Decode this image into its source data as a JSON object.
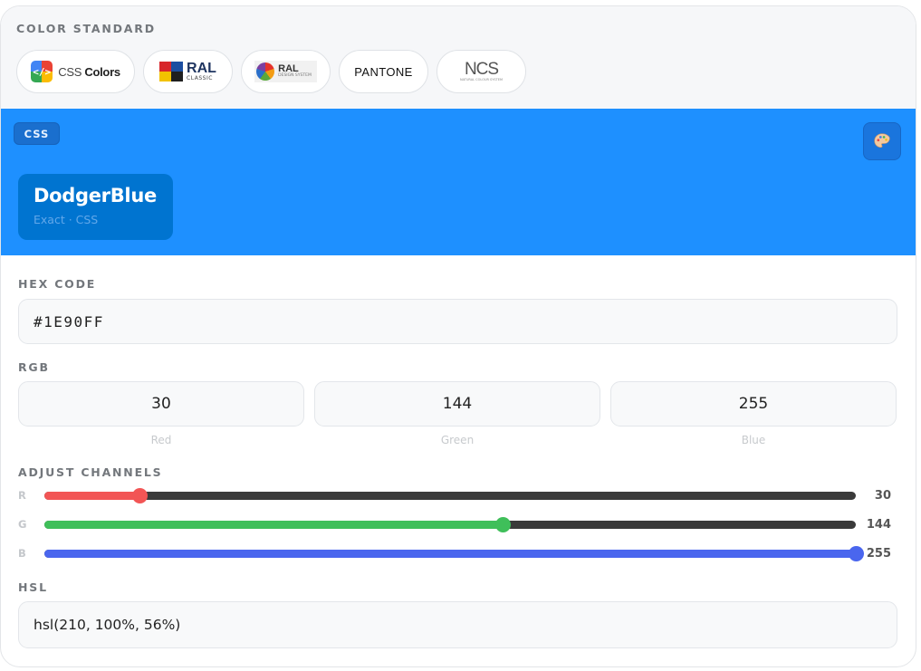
{
  "color_standard": {
    "label": "COLOR STANDARD",
    "options": [
      {
        "id": "css",
        "label_prefix": "CSS",
        "label_suffix": "Colors"
      },
      {
        "id": "ral-classic",
        "label": "RAL",
        "sub": "CLASSIC"
      },
      {
        "id": "ral-design",
        "label": "RAL",
        "sub": "DESIGN SYSTEM"
      },
      {
        "id": "pantone",
        "label": "PANTONE"
      },
      {
        "id": "ncs",
        "label": "NCS",
        "sub": "NATURAL COLOUR SYSTEM"
      }
    ]
  },
  "banner": {
    "badge": "CSS",
    "background": "#1e90ff",
    "color_name": "DodgerBlue",
    "subtitle": "Exact · CSS",
    "palette_icon": "palette-icon"
  },
  "hex": {
    "label": "HEX CODE",
    "value": "#1E90FF"
  },
  "rgb": {
    "label": "RGB",
    "channels": [
      {
        "value": "30",
        "label": "Red"
      },
      {
        "value": "144",
        "label": "Green"
      },
      {
        "value": "255",
        "label": "Blue"
      }
    ]
  },
  "adjust": {
    "label": "ADJUST CHANNELS",
    "channels": [
      {
        "letter": "R",
        "value": "30",
        "fraction": 0.1176,
        "color": "#f25555"
      },
      {
        "letter": "G",
        "value": "144",
        "fraction": 0.5647,
        "color": "#3fbf5a"
      },
      {
        "letter": "B",
        "value": "255",
        "fraction": 1.0,
        "color": "#4a66ee"
      }
    ]
  },
  "hsl": {
    "label": "HSL",
    "value": "hsl(210, 100%, 56%)"
  }
}
